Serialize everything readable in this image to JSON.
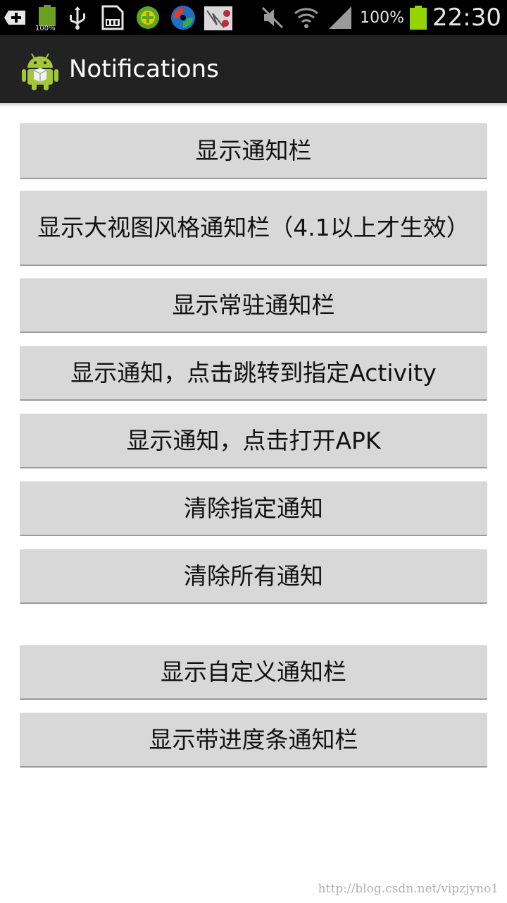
{
  "status_bar": {
    "left_battery_label": "100%",
    "battery_percent": "100%",
    "time": "22:30"
  },
  "action_bar": {
    "title": "Notifications"
  },
  "buttons": [
    {
      "label": "显示通知栏"
    },
    {
      "label": "显示大视图风格通知栏（4.1以上才生效）"
    },
    {
      "label": "显示常驻通知栏"
    },
    {
      "label": "显示通知，点击跳转到指定Activity"
    },
    {
      "label": "显示通知，点击打开APK"
    },
    {
      "label": "清除指定通知"
    },
    {
      "label": "清除所有通知"
    },
    {
      "label": "显示自定义通知栏"
    },
    {
      "label": "显示带进度条通知栏"
    }
  ],
  "watermark": "http://blog.csdn.net/vipzjyno1",
  "colors": {
    "battery": "#94d500",
    "action_bar": "#222222",
    "button": "#d8d8d8"
  }
}
